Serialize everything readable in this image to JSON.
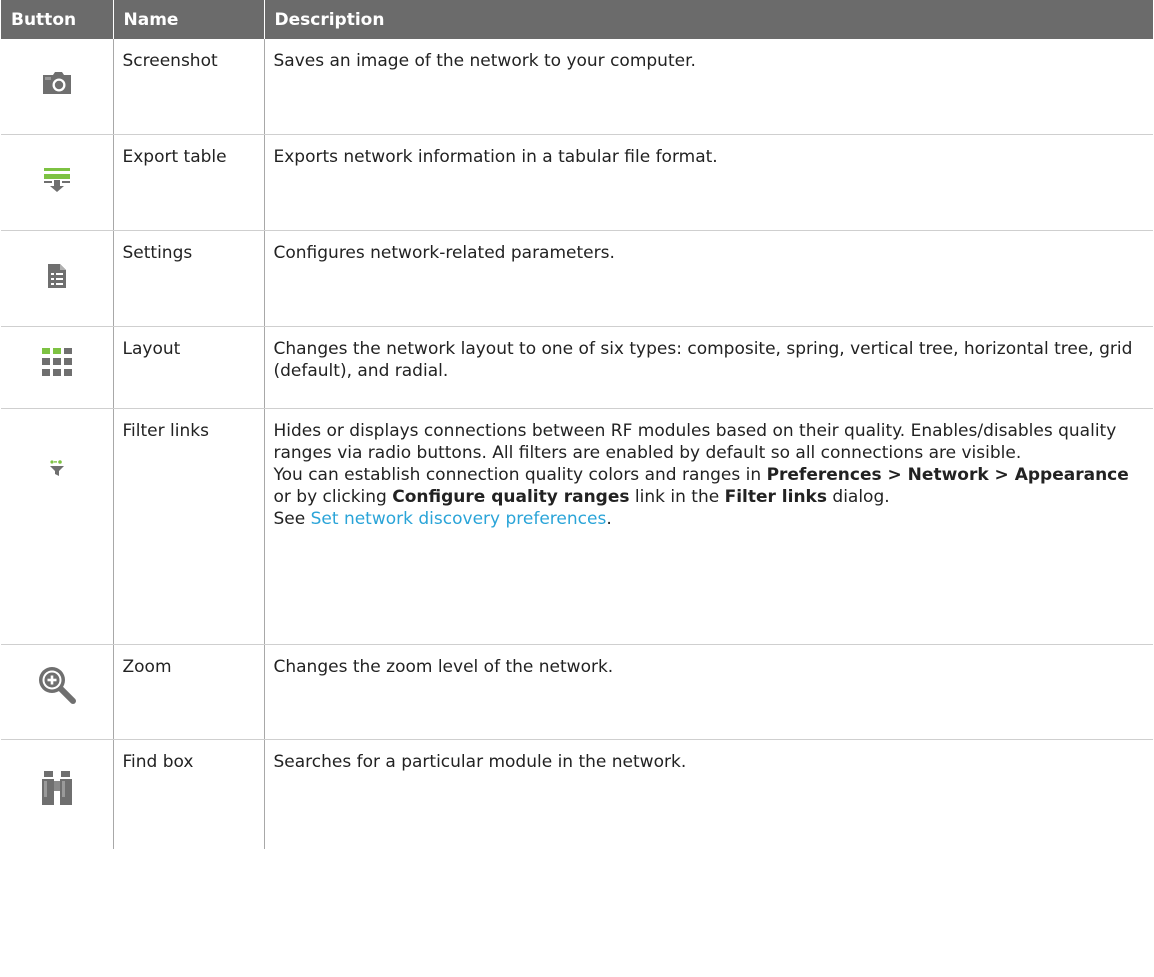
{
  "headers": {
    "button": "Button",
    "name": "Name",
    "description": "Description"
  },
  "rows": [
    {
      "icon": "camera-icon",
      "name": "Screenshot",
      "desc": "Saves an image of the network to your computer."
    },
    {
      "icon": "export-table-icon",
      "name": "Export table",
      "desc": "Exports network information in a tabular file format."
    },
    {
      "icon": "settings-document-icon",
      "name": "Settings",
      "desc": "Configures network-related parameters."
    },
    {
      "icon": "layout-grid-icon",
      "name": "Layout",
      "desc": "Changes the network layout to one of six types: composite, spring, vertical tree, horizontal tree, grid (default), and radial."
    },
    {
      "icon": "filter-funnel-icon",
      "name": "Filter links",
      "desc_line1": "Hides or displays connections between RF modules based on their quality. Enables/disables quality ranges via radio buttons. All filters are enabled by default so all connections are visible.",
      "desc_line2_pre": "You can establish connection quality colors and ranges in ",
      "desc_line2_b1": "Preferences > Network > Appearance",
      "desc_line2_mid": " or by clicking ",
      "desc_line2_b2": "Configure quality ranges",
      "desc_line2_mid2": " link in the ",
      "desc_line2_b3": "Filter links",
      "desc_line2_post": " dialog.",
      "desc_line3_pre": "See ",
      "desc_line3_link": "Set network discovery preferences",
      "desc_line3_post": "."
    },
    {
      "icon": "zoom-magnifier-icon",
      "name": "Zoom",
      "desc": "Changes the zoom level of the network."
    },
    {
      "icon": "binoculars-icon",
      "name": "Find box",
      "desc": "Searches for a particular module in the network."
    }
  ],
  "colors": {
    "header_bg": "#6b6b6b",
    "link": "#2aa4d8",
    "icon_green": "#7dc242",
    "icon_gray": "#6f6f6f"
  }
}
